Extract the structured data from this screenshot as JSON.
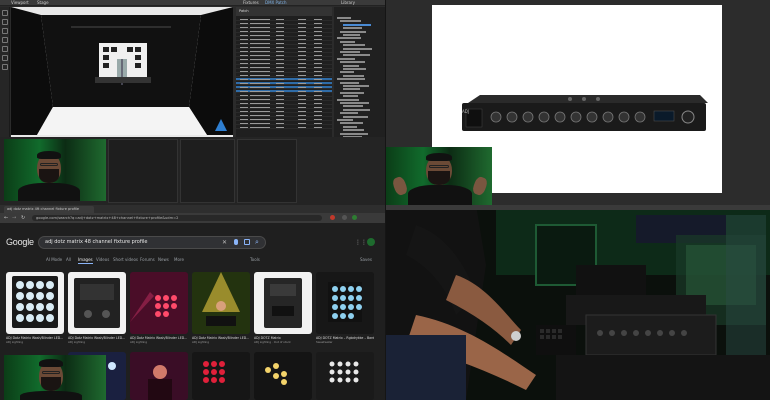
{
  "software": {
    "tabs": [
      "Viewport",
      "Stage"
    ],
    "panel_tabs": [
      "Fixtures",
      "DMX Patch"
    ],
    "panel_title": "Patch",
    "tree_title": "Library"
  },
  "product": {
    "brand_label": "ADJ"
  },
  "browser": {
    "tab_label": "adj dotz matrix 4ft channel fixture profile",
    "url": "google.com/search?q=adj+dotz+matrix+48+channel+fixture+profile&udm=2"
  },
  "google": {
    "logo": "Google",
    "query": "adj dotz matrix 48 channel fixture profile",
    "filters": [
      "AI Mode",
      "All",
      "Images",
      "Videos",
      "Short videos",
      "Forums",
      "News",
      "More"
    ],
    "active_filter": "Images",
    "tools": "Tools",
    "safe": "Saves",
    "results": [
      {
        "caption": "ADJ Dotz Matrix Wash/Blinder LED...",
        "source": "ADJ Lighting"
      },
      {
        "caption": "ADJ Dotz Matrix Wash/Blinder LED...",
        "source": "ADJ Lighting"
      },
      {
        "caption": "ADJ Dotz Matrix Wash/Blinder LED...",
        "source": "ADJ Lighting"
      },
      {
        "caption": "ADJ Dotz Matrix Wash/Blinder LED...",
        "source": "ADJ Lighting"
      },
      {
        "caption": "ADJ DOTZ Matrix",
        "source": "ADJ Lighting · Out of stock"
      },
      {
        "caption": "ADJ DOTZ Matrix – Rgbdrykke – Bard...",
        "source": "Sweetwater"
      }
    ]
  },
  "colors": {
    "green_glow": "#116b2c",
    "accent_blue": "#8ab4f8",
    "selection": "#2f6ca8"
  },
  "icons": {
    "mic": "microphone-icon",
    "lens": "lens-icon",
    "search": "search-icon"
  }
}
